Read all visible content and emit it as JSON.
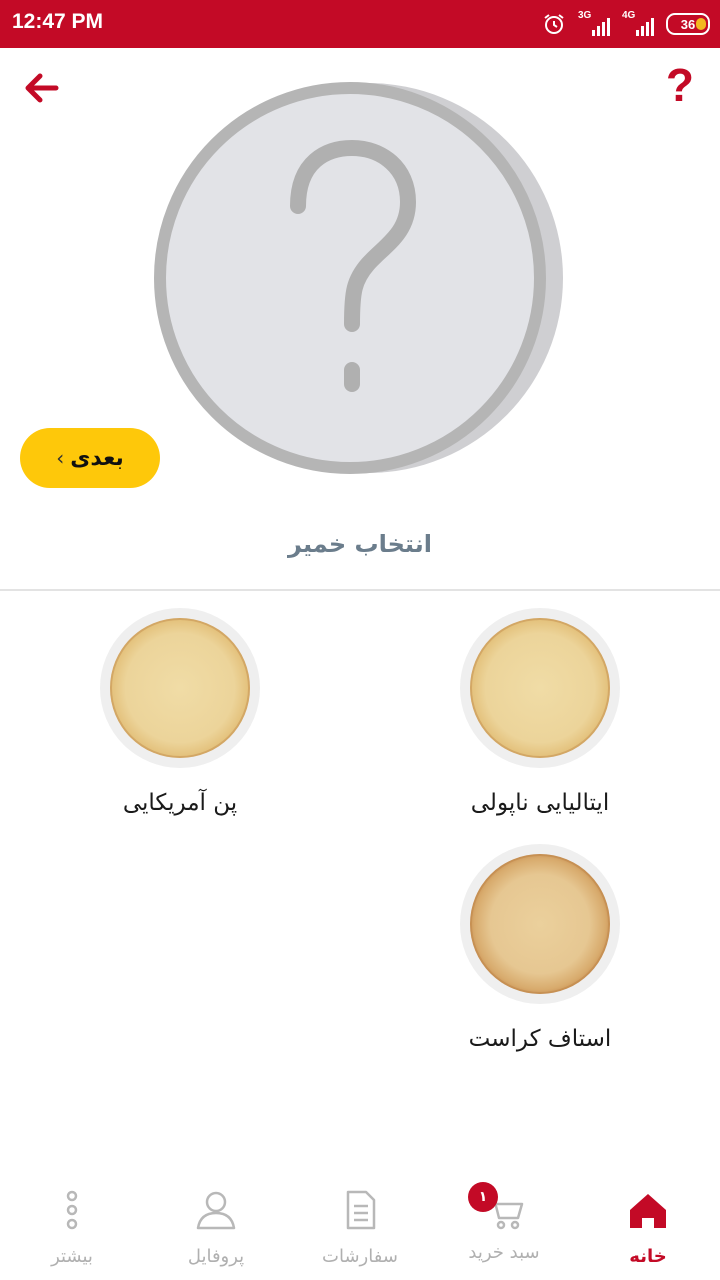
{
  "status_bar": {
    "time": "12:47 PM",
    "network_1": "3G",
    "network_2": "4G",
    "battery": "36"
  },
  "header": {
    "back_icon": "arrow-left-icon",
    "help_label": "?"
  },
  "next_button": {
    "label": "بعدی"
  },
  "section_title": "انتخاب خمیر",
  "dough_options": [
    {
      "label": "ایتالیایی ناپولی"
    },
    {
      "label": "پن آمریکایی"
    },
    {
      "label": "استاف کراست"
    }
  ],
  "bottom_nav": {
    "items": [
      {
        "label": "خانه",
        "icon": "home-icon",
        "active": true
      },
      {
        "label": "سبد خرید",
        "icon": "cart-icon",
        "badge": "۱"
      },
      {
        "label": "سفارشات",
        "icon": "orders-icon"
      },
      {
        "label": "پروفایل",
        "icon": "profile-icon"
      },
      {
        "label": "بیشتر",
        "icon": "more-icon"
      }
    ]
  },
  "colors": {
    "brand": "#c30a26",
    "accent": "#fec80a",
    "title": "#6b7d8c"
  }
}
